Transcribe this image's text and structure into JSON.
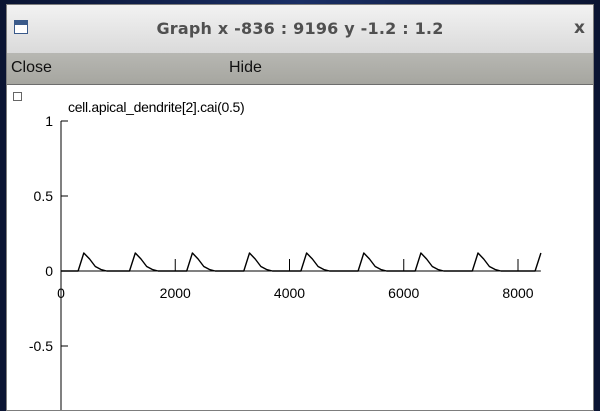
{
  "window": {
    "title": "Graph  x -836 : 9196  y -1.2 : 1.2",
    "close_glyph": "x",
    "icon": "window-icon"
  },
  "menu": {
    "close_label": "Close",
    "hide_label": "Hide"
  },
  "graph": {
    "variable_label": "cell.apical_dendrite[2].cai(0.5)",
    "x_range": [
      -836,
      9196
    ],
    "y_range": [
      -1.2,
      1.2
    ]
  },
  "chart_data": {
    "type": "line",
    "title": "",
    "xlabel": "",
    "ylabel": "",
    "xlim": [
      -836,
      9196
    ],
    "ylim": [
      -1.2,
      1.2
    ],
    "x_ticks": [
      0,
      2000,
      4000,
      6000,
      8000
    ],
    "x_tick_labels": [
      "0",
      "2000",
      "4000",
      "6000",
      "8000"
    ],
    "y_ticks": [
      1,
      0.5,
      0,
      -0.5
    ],
    "y_tick_labels": [
      "1",
      "0.5",
      "0",
      "-0.5"
    ],
    "grid": false,
    "series": [
      {
        "name": "cell.apical_dendrite[2].cai(0.5)",
        "x": [
          0,
          300,
          400,
          500,
          600,
          700,
          800,
          900,
          1000,
          1200,
          1300,
          1400,
          1500,
          1600,
          1700,
          1800,
          1900,
          2000,
          2200,
          2300,
          2400,
          2500,
          2600,
          2700,
          2800,
          2900,
          3000,
          3200,
          3300,
          3400,
          3500,
          3600,
          3700,
          3800,
          3900,
          4000,
          4200,
          4300,
          4400,
          4500,
          4600,
          4700,
          4800,
          4900,
          5000,
          5200,
          5300,
          5400,
          5500,
          5600,
          5700,
          5800,
          5900,
          6000,
          6200,
          6300,
          6400,
          6500,
          6600,
          6700,
          6800,
          6900,
          7000,
          7200,
          7300,
          7400,
          7500,
          7600,
          7700,
          7800,
          7900,
          8000,
          8200,
          8300,
          8400
        ],
        "y": [
          0,
          0,
          0.12,
          0.08,
          0.03,
          0.01,
          0,
          0,
          0,
          0,
          0.12,
          0.08,
          0.03,
          0.01,
          0,
          0,
          0,
          0,
          0,
          0.12,
          0.08,
          0.03,
          0.01,
          0,
          0,
          0,
          0,
          0,
          0.12,
          0.08,
          0.03,
          0.01,
          0,
          0,
          0,
          0,
          0,
          0.12,
          0.08,
          0.03,
          0.01,
          0,
          0,
          0,
          0,
          0,
          0.12,
          0.08,
          0.03,
          0.01,
          0,
          0,
          0,
          0,
          0,
          0.12,
          0.08,
          0.03,
          0.01,
          0,
          0,
          0,
          0,
          0,
          0.12,
          0.08,
          0.03,
          0.01,
          0,
          0,
          0,
          0,
          0,
          0,
          0.12
        ]
      }
    ]
  }
}
